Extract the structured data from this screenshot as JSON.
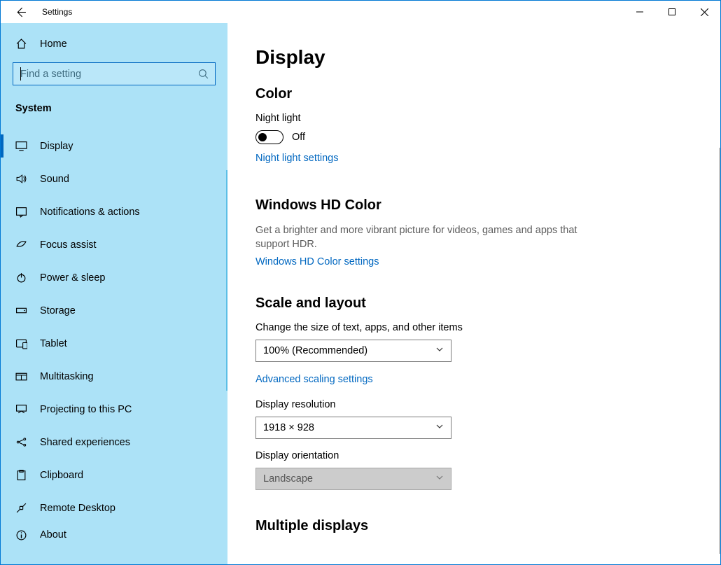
{
  "titlebar": {
    "title": "Settings"
  },
  "sidebar": {
    "home": "Home",
    "search_placeholder": "Find a setting",
    "category": "System",
    "items": [
      {
        "icon": "display",
        "label": "Display",
        "selected": true
      },
      {
        "icon": "sound",
        "label": "Sound"
      },
      {
        "icon": "notifications",
        "label": "Notifications & actions"
      },
      {
        "icon": "focus",
        "label": "Focus assist"
      },
      {
        "icon": "power",
        "label": "Power & sleep"
      },
      {
        "icon": "storage",
        "label": "Storage"
      },
      {
        "icon": "tablet",
        "label": "Tablet"
      },
      {
        "icon": "multitasking",
        "label": "Multitasking"
      },
      {
        "icon": "projecting",
        "label": "Projecting to this PC"
      },
      {
        "icon": "shared",
        "label": "Shared experiences"
      },
      {
        "icon": "clipboard",
        "label": "Clipboard"
      },
      {
        "icon": "remote",
        "label": "Remote Desktop"
      },
      {
        "icon": "about",
        "label": "About"
      }
    ]
  },
  "content": {
    "title": "Display",
    "color_section": "Color",
    "night_light_label": "Night light",
    "night_light_state": "Off",
    "night_light_link": "Night light settings",
    "hd_section": "Windows HD Color",
    "hd_desc": "Get a brighter and more vibrant picture for videos, games and apps that support HDR.",
    "hd_link": "Windows HD Color settings",
    "scale_section": "Scale and layout",
    "scale_label": "Change the size of text, apps, and other items",
    "scale_value": "100% (Recommended)",
    "scale_link": "Advanced scaling settings",
    "resolution_label": "Display resolution",
    "resolution_value": "1918 × 928",
    "orientation_label": "Display orientation",
    "orientation_value": "Landscape",
    "multi_section": "Multiple displays"
  }
}
